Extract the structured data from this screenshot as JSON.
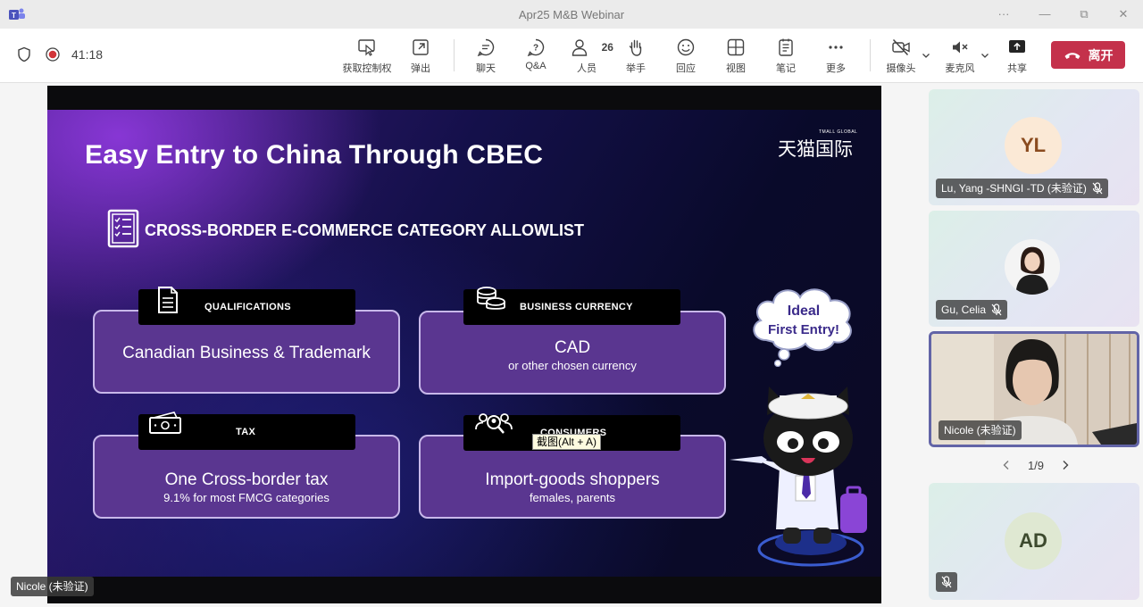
{
  "window": {
    "title": "Apr25 M&B Webinar",
    "controls": {
      "more": "···",
      "minimize": "—",
      "maximize": "⧉",
      "close": "✕"
    }
  },
  "toolbar": {
    "timer": "41:18",
    "buttons": [
      {
        "label": "获取控制权",
        "icon": "take-control-icon"
      },
      {
        "label": "弹出",
        "icon": "pop-out-icon"
      },
      {
        "label": "聊天",
        "icon": "chat-icon"
      },
      {
        "label": "Q&A",
        "icon": "qa-icon"
      },
      {
        "label": "人员",
        "icon": "people-icon",
        "count": "26"
      },
      {
        "label": "举手",
        "icon": "raise-hand-icon"
      },
      {
        "label": "回应",
        "icon": "react-icon"
      },
      {
        "label": "视图",
        "icon": "view-icon"
      },
      {
        "label": "笔记",
        "icon": "notes-icon"
      },
      {
        "label": "更多",
        "icon": "more-icon"
      },
      {
        "label": "摄像头",
        "icon": "camera-off-icon"
      },
      {
        "label": "麦克风",
        "icon": "mic-off-icon"
      },
      {
        "label": "共享",
        "icon": "share-icon"
      }
    ],
    "leave_label": "离开",
    "leave_color": "#c4314b"
  },
  "slide": {
    "title": "Easy Entry to China Through CBEC",
    "brand_small": "TMALL GLOBAL",
    "brand_cn": "天猫国际",
    "subhead": "CROSS-BORDER E-COMMERCE CATEGORY ALLOWLIST",
    "cards": [
      {
        "tag": "QUALIFICATIONS",
        "icon": "document-icon",
        "main": "Canadian Business & Trademark",
        "sub": ""
      },
      {
        "tag": "BUSINESS CURRENCY",
        "icon": "coins-icon",
        "main": "CAD",
        "sub": "or other chosen currency"
      },
      {
        "tag": "TAX",
        "icon": "cash-icon",
        "main": "One Cross-border tax",
        "sub": "9.1% for most FMCG categories"
      },
      {
        "tag": "CONSUMERS",
        "icon": "group-search-icon",
        "main": "Import-goods shoppers",
        "sub": "females, parents"
      }
    ],
    "bubble_line1": "Ideal",
    "bubble_line2": "First  Entry!",
    "card_color": "#5a3690"
  },
  "tooltip": "截图(Alt + A)",
  "presenter_name": "Nicole (未验证)",
  "participants": [
    {
      "initials": "YL",
      "name": "Lu, Yang -SHNGI -TD (未验证)",
      "avatar_bg": "#fbe9d6",
      "avatar_fg": "#8a4b1f"
    },
    {
      "initials": "",
      "name": "Gu, Celia",
      "avatar_bg": "#ffffff",
      "avatar_fg": "#333333"
    },
    {
      "initials": "",
      "name": "Nicole (未验证)",
      "avatar_bg": "#d8c8b8",
      "avatar_fg": "#333333"
    },
    {
      "initials": "AD",
      "name": "",
      "avatar_bg": "#dfe8d2",
      "avatar_fg": "#3d4a2e"
    }
  ],
  "pager": {
    "text": "1/9"
  }
}
